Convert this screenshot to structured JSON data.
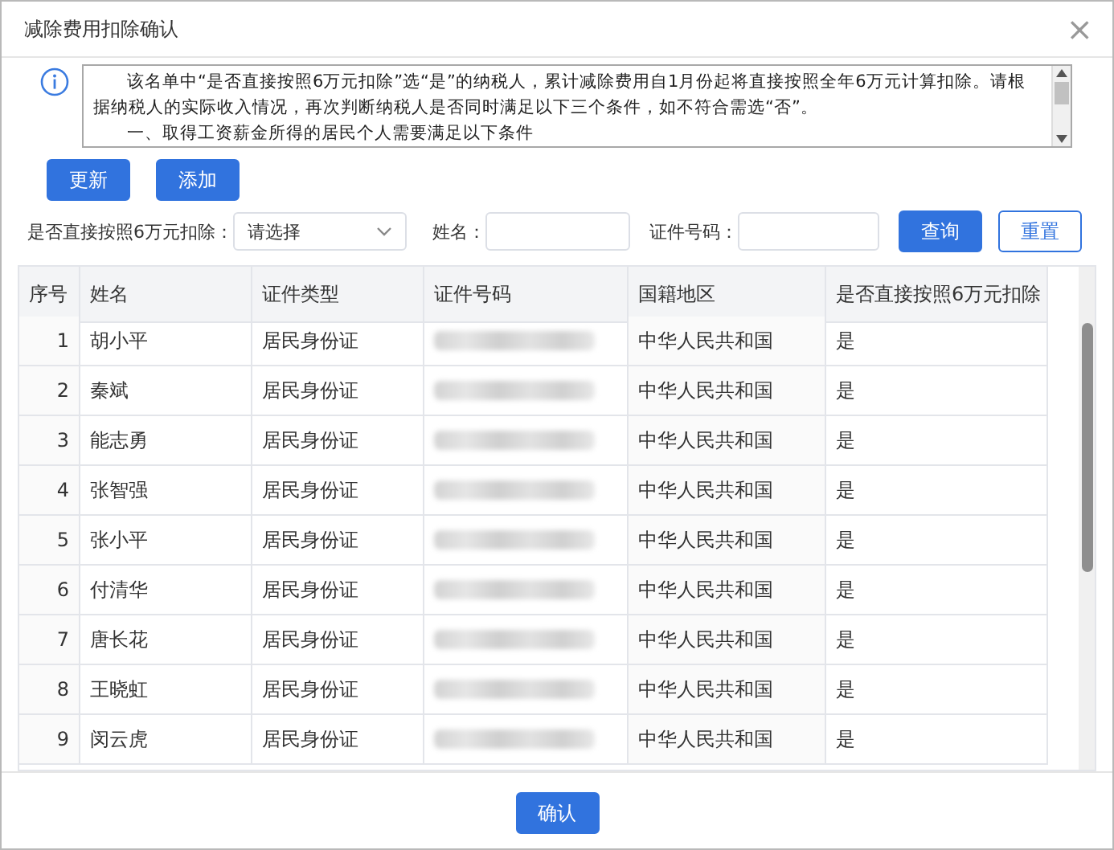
{
  "window": {
    "title": "减除费用扣除确认",
    "close": "×"
  },
  "notice": {
    "paragraphs": [
      "该名单中“是否直接按照6万元扣除”选“是”的纳税人，累计减除费用自1月份起将直接按照全年6万元计算扣除。请根据纳税人的实际收入情况，再次判断纳税人是否同时满足以下三个条件，如不符合需选“否”。",
      "一、取得工资薪金所得的居民个人需要满足以下条件"
    ]
  },
  "actions": [
    "更新",
    "添加"
  ],
  "filters": [
    {
      "kind": "select",
      "label": "是否直接按照6万元扣除：",
      "value": "请选择"
    },
    {
      "kind": "input",
      "label": "姓名："
    },
    {
      "kind": "input",
      "label": "证件号码："
    }
  ],
  "filter_buttons": [
    {
      "label": "查询",
      "kind": "primary"
    },
    {
      "label": "重置",
      "kind": "outline"
    }
  ],
  "table": {
    "columns": [
      "序号",
      "姓名",
      "证件类型",
      "证件号码",
      "国籍地区",
      "是否直接按照6万元扣除"
    ],
    "rows": [
      {
        "index": "1",
        "name": "胡小平",
        "id_type": "居民身份证",
        "nationality": "中华人民共和国",
        "direct_deduction": "是"
      },
      {
        "index": "2",
        "name": "秦斌",
        "id_type": "居民身份证",
        "nationality": "中华人民共和国",
        "direct_deduction": "是"
      },
      {
        "index": "3",
        "name": "能志勇",
        "id_type": "居民身份证",
        "nationality": "中华人民共和国",
        "direct_deduction": "是"
      },
      {
        "index": "4",
        "name": "张智强",
        "id_type": "居民身份证",
        "nationality": "中华人民共和国",
        "direct_deduction": "是"
      },
      {
        "index": "5",
        "name": "张小平",
        "id_type": "居民身份证",
        "nationality": "中华人民共和国",
        "direct_deduction": "是"
      },
      {
        "index": "6",
        "name": "付清华",
        "id_type": "居民身份证",
        "nationality": "中华人民共和国",
        "direct_deduction": "是"
      },
      {
        "index": "7",
        "name": "唐长花",
        "id_type": "居民身份证",
        "nationality": "中华人民共和国",
        "direct_deduction": "是"
      },
      {
        "index": "8",
        "name": "王晓虹",
        "id_type": "居民身份证",
        "nationality": "中华人民共和国",
        "direct_deduction": "是"
      },
      {
        "index": "9",
        "name": "闵云虎",
        "id_type": "居民身份证",
        "nationality": "中华人民共和国",
        "direct_deduction": "是"
      }
    ]
  },
  "footer": {
    "button": "确认"
  }
}
